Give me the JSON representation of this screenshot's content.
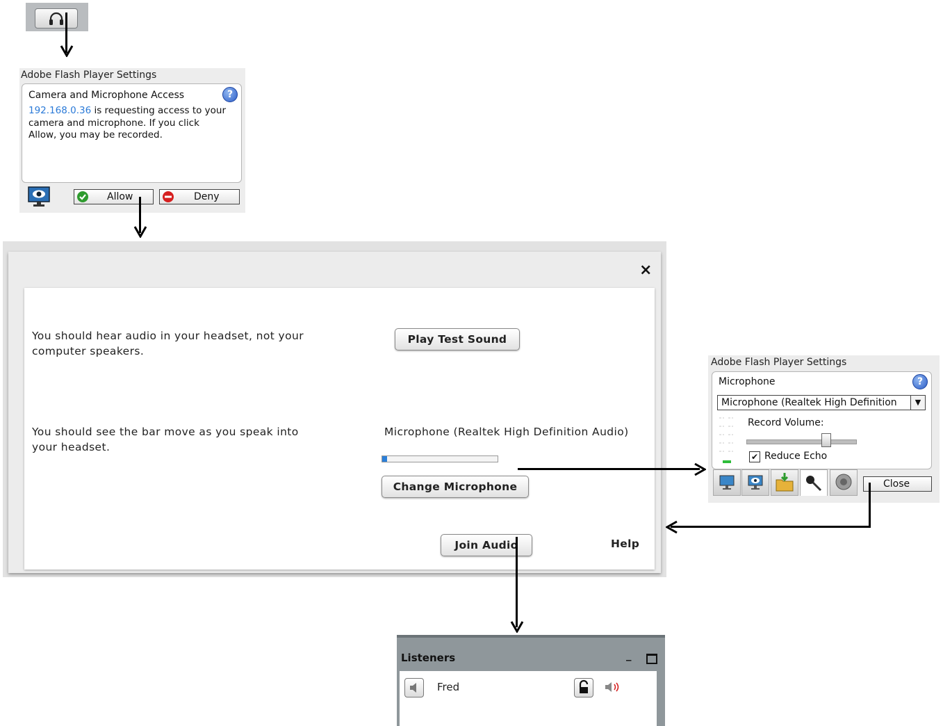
{
  "flash_settings_1": {
    "title": "Adobe Flash Player Settings",
    "heading": "Camera and Microphone Access",
    "requester_ip": "192.168.0.36",
    "message": " is requesting access to your camera and microphone. If you click Allow, you may be recorded.",
    "allow_label": "Allow",
    "deny_label": "Deny"
  },
  "audio_dialog": {
    "close_label": "×",
    "headset_hint": "You should hear audio in your headset, not your computer speakers.",
    "play_test_sound_label": "Play Test Sound",
    "mic_hint": "You should see the bar move as you speak into your headset.",
    "microphone_name": "Microphone (Realtek High Definition Audio)",
    "mic_level_percent": 4,
    "change_microphone_label": "Change Microphone",
    "join_audio_label": "Join Audio",
    "help_label": "Help"
  },
  "flash_settings_2": {
    "title": "Adobe Flash Player Settings",
    "heading": "Microphone",
    "selected_microphone": "Microphone (Realtek High Definition",
    "record_volume_label": "Record Volume:",
    "record_volume_fraction": 0.72,
    "reduce_echo_label": "Reduce Echo",
    "reduce_echo_checked": true,
    "close_label": "Close"
  },
  "listeners_panel": {
    "title": "Listeners",
    "minimize_label": "_",
    "listeners": [
      {
        "name": "Fred"
      }
    ]
  },
  "colors": {
    "link_blue": "#2a7ad8",
    "mic_fill": "#2b7fd8",
    "allow_green": "#2e9b2e",
    "deny_red": "#d62020",
    "panel_gray": "#8f979b"
  }
}
